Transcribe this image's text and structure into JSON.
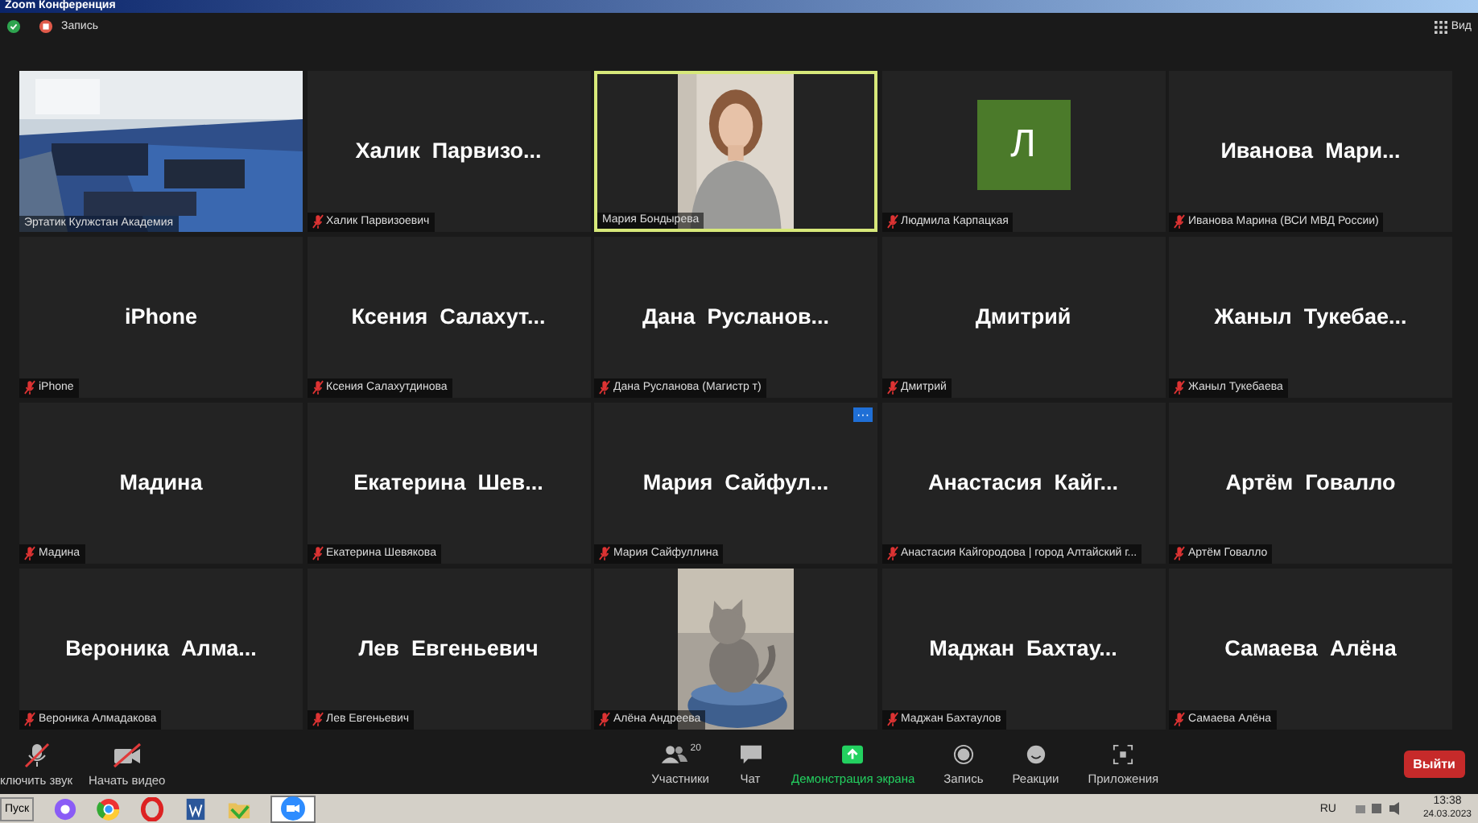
{
  "window": {
    "title": "Zoom Конференция"
  },
  "top_bar": {
    "recording": "Запись",
    "view": "Вид"
  },
  "tiles": [
    {
      "kind": "picture",
      "label": "Эртатик Кулжстан Академия",
      "muted": false,
      "speaking": false
    },
    {
      "kind": "name",
      "name": "Халик  Парвизо...",
      "label": "Халик Парвизоевич",
      "muted": true,
      "speaking": false
    },
    {
      "kind": "picture",
      "label": "Мария Бондырева",
      "muted": false,
      "speaking": true
    },
    {
      "kind": "avatar",
      "initial": "Л",
      "label": "Людмила Карпацкая",
      "muted": true,
      "speaking": false
    },
    {
      "kind": "name",
      "name": "Иванова  Мари...",
      "label": "Иванова Марина (ВСИ МВД России)",
      "muted": true,
      "speaking": false
    },
    {
      "kind": "name",
      "name": "iPhone",
      "label": "iPhone",
      "muted": true,
      "speaking": false
    },
    {
      "kind": "name",
      "name": "Ксения  Салахут...",
      "label": "Ксения Салахутдинова",
      "muted": true,
      "speaking": false
    },
    {
      "kind": "name",
      "name": "Дана  Русланов...",
      "label": "Дана Русланова (Магистр т)",
      "muted": true,
      "speaking": false
    },
    {
      "kind": "name",
      "name": "Дмитрий",
      "label": "Дмитрий",
      "muted": true,
      "speaking": false
    },
    {
      "kind": "name",
      "name": "Жаныл  Тукебае...",
      "label": "Жаныл Тукебаева",
      "muted": true,
      "speaking": false
    },
    {
      "kind": "name",
      "name": "Мадина",
      "label": "Мадина",
      "muted": true,
      "speaking": false
    },
    {
      "kind": "name",
      "name": "Екатерина  Шев...",
      "label": "Екатерина Шевякова",
      "muted": true,
      "speaking": false
    },
    {
      "kind": "name",
      "name": "Мария  Сайфул...",
      "label": "Мария Сайфуллина",
      "muted": true,
      "speaking": false,
      "badge": "···"
    },
    {
      "kind": "name",
      "name": "Анастасия  Кайг...",
      "label": "Анастасия Кайгородова | город Алтайский г...",
      "muted": true,
      "speaking": false
    },
    {
      "kind": "name",
      "name": "Артём  Говалло",
      "label": "Артём Говалло",
      "muted": true,
      "speaking": false
    },
    {
      "kind": "name",
      "name": "Вероника  Алма...",
      "label": "Вероника Алмадакова",
      "muted": true,
      "speaking": false
    },
    {
      "kind": "name",
      "name": "Лев  Евгеньевич",
      "label": "Лев Евгеньевич",
      "muted": true,
      "speaking": false
    },
    {
      "kind": "picture",
      "label": "Алёна Андреева",
      "muted": true,
      "speaking": false
    },
    {
      "kind": "name",
      "name": "Маджан  Бахтау...",
      "label": "Маджан Бахтаулов",
      "muted": true,
      "speaking": false
    },
    {
      "kind": "name",
      "name": "Самаева  Алёна",
      "label": "Самаева Алёна",
      "muted": true,
      "speaking": false
    }
  ],
  "toolbar": {
    "left": [
      {
        "label": "ключить звук"
      },
      {
        "label": "Начать видео"
      }
    ],
    "center": [
      {
        "label": "Участники",
        "count": "20"
      },
      {
        "label": "Чат"
      },
      {
        "label": "Демонстрация экрана"
      },
      {
        "label": "Запись"
      },
      {
        "label": "Реакции"
      },
      {
        "label": "Приложения"
      }
    ],
    "leave": "Выйти"
  },
  "taskbar": {
    "start": "Пуск",
    "language": "RU",
    "time": "13:38",
    "date": "24.03.2023"
  }
}
